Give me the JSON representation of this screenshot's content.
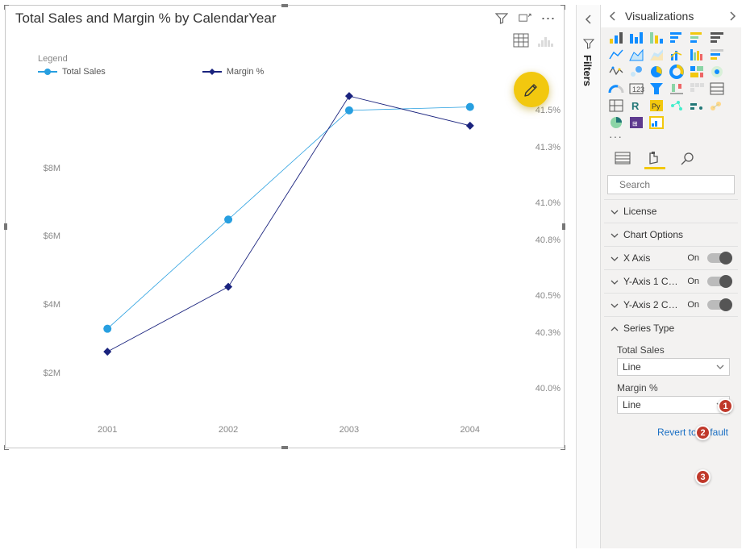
{
  "chart": {
    "title": "Total Sales and Margin % by CalendarYear",
    "legend_title": "Legend",
    "legend_items": [
      "Total Sales",
      "Margin %"
    ]
  },
  "chart_data": {
    "type": "line",
    "categories": [
      "2001",
      "2002",
      "2003",
      "2004"
    ],
    "series": [
      {
        "name": "Total Sales",
        "axis": "left",
        "color": "#279fe0",
        "marker": "circle",
        "values": [
          3.3,
          6.5,
          9.7,
          9.8
        ]
      },
      {
        "name": "Margin %",
        "axis": "right",
        "color": "#1a237e",
        "marker": "diamond",
        "values": [
          40.2,
          40.55,
          41.58,
          41.42
        ]
      }
    ],
    "y_left": {
      "label": "",
      "unit": "$M",
      "ticks": [
        2,
        4,
        6,
        8
      ],
      "range": [
        1,
        10.5
      ]
    },
    "y_right": {
      "label": "",
      "unit": "%",
      "ticks": [
        40.0,
        40.3,
        40.5,
        40.8,
        41.0,
        41.3,
        41.5
      ],
      "range": [
        39.9,
        41.65
      ]
    }
  },
  "filters_label": "Filters",
  "viz": {
    "title": "Visualizations",
    "search_placeholder": "Search",
    "more_dots": "···",
    "sections": {
      "license": "License",
      "chart_options": "Chart Options",
      "x_axis": "X Axis",
      "y1": "Y-Axis 1 C…",
      "y2": "Y-Axis 2 C…",
      "series_type": "Series Type",
      "on_label": "On"
    },
    "series_fields": [
      {
        "label": "Total Sales",
        "value": "Line"
      },
      {
        "label": "Margin %",
        "value": "Line"
      }
    ],
    "revert": "Revert to default"
  },
  "badges": [
    "1",
    "2",
    "3"
  ]
}
